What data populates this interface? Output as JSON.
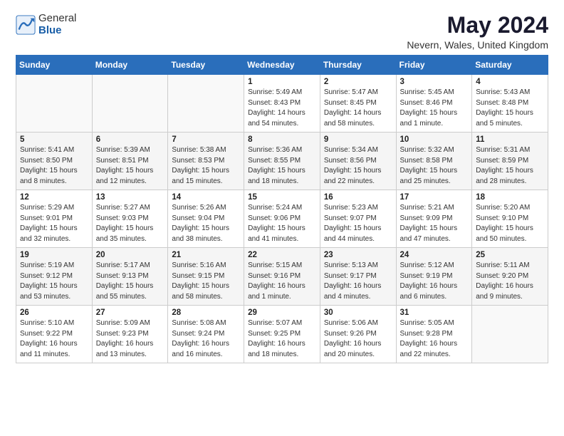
{
  "logo": {
    "general": "General",
    "blue": "Blue"
  },
  "title": "May 2024",
  "location": "Nevern, Wales, United Kingdom",
  "days_of_week": [
    "Sunday",
    "Monday",
    "Tuesday",
    "Wednesday",
    "Thursday",
    "Friday",
    "Saturday"
  ],
  "weeks": [
    [
      {
        "day": "",
        "info": ""
      },
      {
        "day": "",
        "info": ""
      },
      {
        "day": "",
        "info": ""
      },
      {
        "day": "1",
        "info": "Sunrise: 5:49 AM\nSunset: 8:43 PM\nDaylight: 14 hours\nand 54 minutes."
      },
      {
        "day": "2",
        "info": "Sunrise: 5:47 AM\nSunset: 8:45 PM\nDaylight: 14 hours\nand 58 minutes."
      },
      {
        "day": "3",
        "info": "Sunrise: 5:45 AM\nSunset: 8:46 PM\nDaylight: 15 hours\nand 1 minute."
      },
      {
        "day": "4",
        "info": "Sunrise: 5:43 AM\nSunset: 8:48 PM\nDaylight: 15 hours\nand 5 minutes."
      }
    ],
    [
      {
        "day": "5",
        "info": "Sunrise: 5:41 AM\nSunset: 8:50 PM\nDaylight: 15 hours\nand 8 minutes."
      },
      {
        "day": "6",
        "info": "Sunrise: 5:39 AM\nSunset: 8:51 PM\nDaylight: 15 hours\nand 12 minutes."
      },
      {
        "day": "7",
        "info": "Sunrise: 5:38 AM\nSunset: 8:53 PM\nDaylight: 15 hours\nand 15 minutes."
      },
      {
        "day": "8",
        "info": "Sunrise: 5:36 AM\nSunset: 8:55 PM\nDaylight: 15 hours\nand 18 minutes."
      },
      {
        "day": "9",
        "info": "Sunrise: 5:34 AM\nSunset: 8:56 PM\nDaylight: 15 hours\nand 22 minutes."
      },
      {
        "day": "10",
        "info": "Sunrise: 5:32 AM\nSunset: 8:58 PM\nDaylight: 15 hours\nand 25 minutes."
      },
      {
        "day": "11",
        "info": "Sunrise: 5:31 AM\nSunset: 8:59 PM\nDaylight: 15 hours\nand 28 minutes."
      }
    ],
    [
      {
        "day": "12",
        "info": "Sunrise: 5:29 AM\nSunset: 9:01 PM\nDaylight: 15 hours\nand 32 minutes."
      },
      {
        "day": "13",
        "info": "Sunrise: 5:27 AM\nSunset: 9:03 PM\nDaylight: 15 hours\nand 35 minutes."
      },
      {
        "day": "14",
        "info": "Sunrise: 5:26 AM\nSunset: 9:04 PM\nDaylight: 15 hours\nand 38 minutes."
      },
      {
        "day": "15",
        "info": "Sunrise: 5:24 AM\nSunset: 9:06 PM\nDaylight: 15 hours\nand 41 minutes."
      },
      {
        "day": "16",
        "info": "Sunrise: 5:23 AM\nSunset: 9:07 PM\nDaylight: 15 hours\nand 44 minutes."
      },
      {
        "day": "17",
        "info": "Sunrise: 5:21 AM\nSunset: 9:09 PM\nDaylight: 15 hours\nand 47 minutes."
      },
      {
        "day": "18",
        "info": "Sunrise: 5:20 AM\nSunset: 9:10 PM\nDaylight: 15 hours\nand 50 minutes."
      }
    ],
    [
      {
        "day": "19",
        "info": "Sunrise: 5:19 AM\nSunset: 9:12 PM\nDaylight: 15 hours\nand 53 minutes."
      },
      {
        "day": "20",
        "info": "Sunrise: 5:17 AM\nSunset: 9:13 PM\nDaylight: 15 hours\nand 55 minutes."
      },
      {
        "day": "21",
        "info": "Sunrise: 5:16 AM\nSunset: 9:15 PM\nDaylight: 15 hours\nand 58 minutes."
      },
      {
        "day": "22",
        "info": "Sunrise: 5:15 AM\nSunset: 9:16 PM\nDaylight: 16 hours\nand 1 minute."
      },
      {
        "day": "23",
        "info": "Sunrise: 5:13 AM\nSunset: 9:17 PM\nDaylight: 16 hours\nand 4 minutes."
      },
      {
        "day": "24",
        "info": "Sunrise: 5:12 AM\nSunset: 9:19 PM\nDaylight: 16 hours\nand 6 minutes."
      },
      {
        "day": "25",
        "info": "Sunrise: 5:11 AM\nSunset: 9:20 PM\nDaylight: 16 hours\nand 9 minutes."
      }
    ],
    [
      {
        "day": "26",
        "info": "Sunrise: 5:10 AM\nSunset: 9:22 PM\nDaylight: 16 hours\nand 11 minutes."
      },
      {
        "day": "27",
        "info": "Sunrise: 5:09 AM\nSunset: 9:23 PM\nDaylight: 16 hours\nand 13 minutes."
      },
      {
        "day": "28",
        "info": "Sunrise: 5:08 AM\nSunset: 9:24 PM\nDaylight: 16 hours\nand 16 minutes."
      },
      {
        "day": "29",
        "info": "Sunrise: 5:07 AM\nSunset: 9:25 PM\nDaylight: 16 hours\nand 18 minutes."
      },
      {
        "day": "30",
        "info": "Sunrise: 5:06 AM\nSunset: 9:26 PM\nDaylight: 16 hours\nand 20 minutes."
      },
      {
        "day": "31",
        "info": "Sunrise: 5:05 AM\nSunset: 9:28 PM\nDaylight: 16 hours\nand 22 minutes."
      },
      {
        "day": "",
        "info": ""
      }
    ]
  ]
}
